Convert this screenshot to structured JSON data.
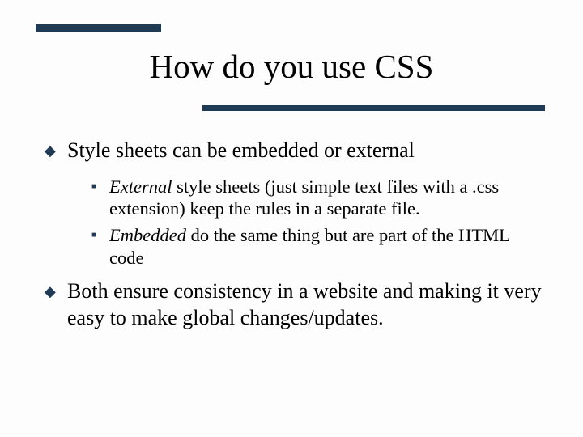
{
  "title": "How do you use CSS",
  "bullets": [
    {
      "text": "Style sheets can be embedded or external",
      "sub": [
        {
          "emph": "External",
          "rest": " style sheets (just simple text files with a .css extension) keep the rules in a separate file."
        },
        {
          "emph": "Embedded",
          "rest": " do the same thing but are part of the HTML code"
        }
      ]
    },
    {
      "text": "Both ensure consistency in a website and making it very easy to make global changes/updates.",
      "sub": []
    }
  ]
}
